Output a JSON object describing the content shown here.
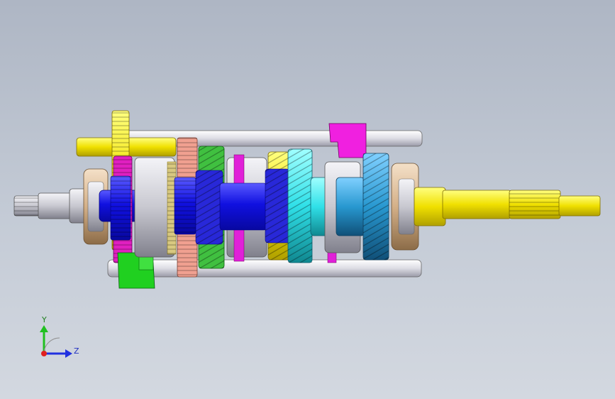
{
  "scene": "transmission-gearbox-assembly-3d-model",
  "view": {
    "triad": {
      "y_label": "Y",
      "z_label": "Z"
    }
  },
  "colors": {
    "background_top": "#aeb6c4",
    "background_bottom": "#d3d8e0",
    "main_shaft": "#1a1ae0",
    "output_shaft": "#f2e600",
    "rods": "#e8e8ec",
    "gear_yellow": "#f0d800",
    "gear_magenta": "#e020c0",
    "gear_salmon": "#f0a090",
    "gear_green": "#40c040",
    "gear_cyan": "#40e0e8",
    "gear_teal": "#30a0d0",
    "fork_magenta": "#f020e0",
    "fork_green": "#20d020",
    "bearing_tan": "#d8b890"
  }
}
